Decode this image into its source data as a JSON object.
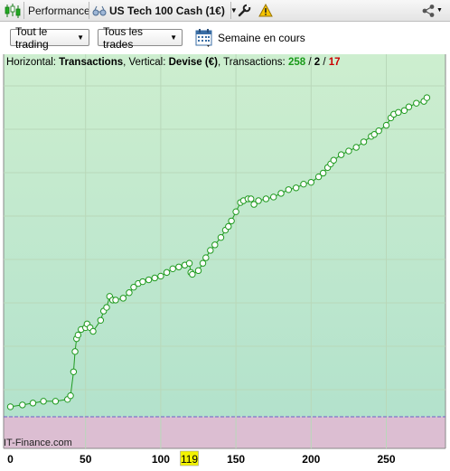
{
  "toolbar": {
    "performance_label": "Performance",
    "instrument_label": "US Tech 100 Cash (1€)"
  },
  "controls": {
    "trading_filter": "Tout le trading",
    "trades_filter": "Tous les trades",
    "period_label": "Semaine en cours"
  },
  "chart_header": {
    "horizontal_prefix": "Horizontal: ",
    "horizontal_value": "Transactions",
    "vertical_prefix": ", Vertical: ",
    "vertical_value": "Devise (€)",
    "transactions_prefix": ", Transactions: ",
    "total": "258",
    "sep1": " / ",
    "neutral": "2",
    "sep2": " / ",
    "losers": "17"
  },
  "watermark": "IT-Finance.com",
  "colors": {
    "profit_zone": "#c7eccb",
    "loss_zone": "#dcbed2",
    "equity_line": "#1f9a1f",
    "loss_segment": "#cc1111",
    "baseline": "#6b5fc7",
    "total_color": "#1a9a1a",
    "losers_color": "#cc0000",
    "cursor_badge": "#f2f200"
  },
  "chart_data": {
    "type": "line",
    "x_axis": {
      "ticks": [
        "0",
        "50",
        "100",
        "150",
        "200",
        "250"
      ],
      "tick_values": [
        0,
        50,
        100,
        150,
        200,
        250
      ],
      "range": [
        0,
        278
      ],
      "cursor_value": "119"
    },
    "y_axis": {
      "labels": []
    },
    "grid": true,
    "series": [
      {
        "points": [
          [
            0,
            2
          ],
          [
            8,
            3
          ],
          [
            15,
            4
          ],
          [
            22,
            5
          ],
          [
            30,
            5
          ],
          [
            38,
            6
          ],
          [
            40,
            8
          ],
          [
            42,
            21
          ],
          [
            43,
            32
          ],
          [
            44,
            39
          ],
          [
            45,
            41
          ],
          [
            47,
            44
          ],
          [
            50,
            45
          ],
          [
            51,
            47
          ],
          [
            53,
            45
          ],
          [
            55,
            43
          ],
          [
            60,
            49
          ],
          [
            62,
            54
          ],
          [
            64,
            56
          ],
          [
            66,
            62
          ],
          [
            68,
            60
          ],
          [
            70,
            60
          ],
          [
            75,
            61
          ],
          [
            79,
            64
          ],
          [
            82,
            67
          ],
          [
            85,
            69
          ],
          [
            88,
            70
          ],
          [
            92,
            71
          ],
          [
            96,
            72
          ],
          [
            100,
            73
          ],
          [
            104,
            75
          ],
          [
            108,
            77
          ],
          [
            112,
            78
          ],
          [
            116,
            79
          ],
          [
            119,
            80
          ],
          [
            120,
            75
          ],
          [
            121,
            74
          ],
          [
            125,
            76
          ],
          [
            128,
            80
          ],
          [
            130,
            83
          ],
          [
            133,
            87
          ],
          [
            136,
            90
          ],
          [
            140,
            94
          ],
          [
            143,
            98
          ],
          [
            145,
            100
          ],
          [
            147,
            103
          ],
          [
            150,
            108
          ],
          [
            153,
            113
          ],
          [
            155,
            114
          ],
          [
            158,
            115
          ],
          [
            160,
            115
          ],
          [
            162,
            112
          ],
          [
            165,
            114
          ],
          [
            170,
            115
          ],
          [
            175,
            116
          ],
          [
            180,
            118
          ],
          [
            185,
            120
          ],
          [
            190,
            121
          ],
          [
            195,
            123
          ],
          [
            200,
            124
          ],
          [
            205,
            127
          ],
          [
            208,
            129
          ],
          [
            211,
            132
          ],
          [
            213,
            134
          ],
          [
            215,
            136
          ],
          [
            220,
            139
          ],
          [
            225,
            141
          ],
          [
            230,
            143
          ],
          [
            235,
            146
          ],
          [
            240,
            149
          ],
          [
            242,
            150
          ],
          [
            245,
            152
          ],
          [
            250,
            155
          ],
          [
            253,
            159
          ],
          [
            255,
            161
          ],
          [
            258,
            162
          ],
          [
            262,
            163
          ],
          [
            265,
            165
          ],
          [
            270,
            167
          ],
          [
            275,
            168
          ],
          [
            277,
            170
          ]
        ],
        "loss_segments_at_x": [
          51,
          62,
          68,
          119,
          160
        ]
      }
    ]
  }
}
